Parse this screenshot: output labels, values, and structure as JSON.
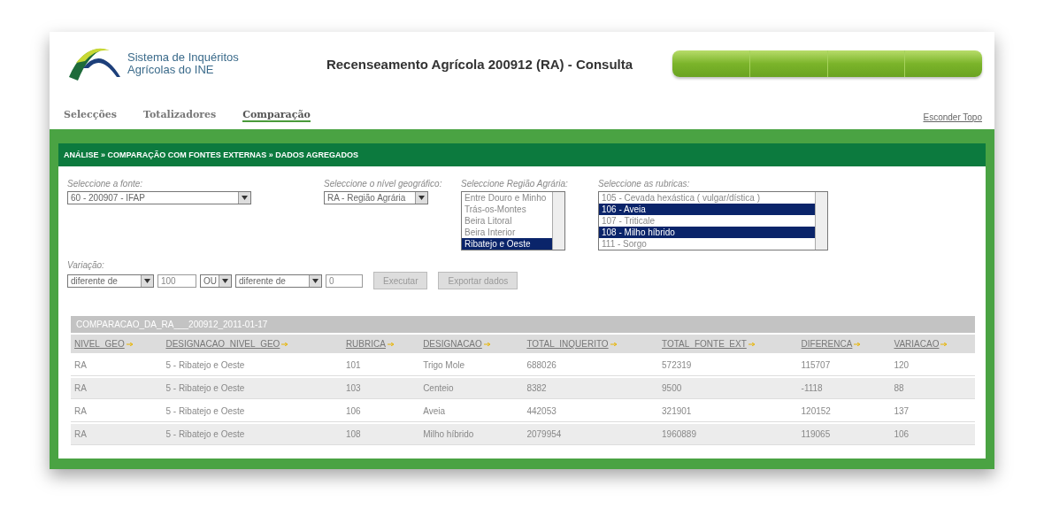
{
  "header": {
    "logo_lines": [
      "Sistema de Inquéritos",
      "Agrícolas do INE"
    ],
    "title": "Recenseamento Agrícola 200912 (RA) - Consulta"
  },
  "nav": {
    "tabs": [
      {
        "label": "Selecções",
        "selected": false
      },
      {
        "label": "Totalizadores",
        "selected": false
      },
      {
        "label": "Comparação",
        "selected": true
      }
    ],
    "hide_link": "Esconder Topo"
  },
  "breadcrumb": "ANÁLISE » COMPARAÇÃO COM FONTES EXTERNAS » DADOS AGREGADOS",
  "filters": {
    "source": {
      "label": "Seleccione a fonte:",
      "value": "60 - 200907 - IFAP"
    },
    "level": {
      "label": "Seleccione o nível geográfico:",
      "value": "RA - Região Agrária"
    },
    "region": {
      "label": "Seleccione Região Agrária:",
      "options": [
        {
          "label": "Entre Douro e Minho",
          "selected": false
        },
        {
          "label": "Trás-os-Montes",
          "selected": false
        },
        {
          "label": "Beira Litoral",
          "selected": false
        },
        {
          "label": "Beira Interior",
          "selected": false
        },
        {
          "label": "Ribatejo e Oeste",
          "selected": true
        }
      ]
    },
    "rubrics": {
      "label": "Seleccione as rubricas:",
      "options": [
        {
          "label": "105 - Cevada hexástica ( vulgar/dística )",
          "selected": false
        },
        {
          "label": "106 - Aveia",
          "selected": true
        },
        {
          "label": "107 - Triticale",
          "selected": false
        },
        {
          "label": "108 - Milho híbrido",
          "selected": true
        },
        {
          "label": "111 - Sorgo",
          "selected": false
        }
      ]
    }
  },
  "variation": {
    "label": "Variação:",
    "controls": [
      {
        "kind": "select",
        "value": "diferente de"
      },
      {
        "kind": "input",
        "value": "100"
      },
      {
        "kind": "select",
        "value": "OU"
      },
      {
        "kind": "select",
        "value": "diferente de"
      },
      {
        "kind": "input",
        "value": "0"
      },
      {
        "kind": "button",
        "value": "Executar"
      },
      {
        "kind": "button",
        "value": "Exportar dados"
      }
    ]
  },
  "table": {
    "caption": "COMPARACAO_DA_RA___200912_2011-01-17",
    "columns": [
      "NIVEL_GEO",
      "DESIGNACAO_NIVEL_GEO",
      "RUBRICA",
      "DESIGNACAO",
      "TOTAL_INQUERITO",
      "TOTAL_FONTE_EXT",
      "DIFERENCA",
      "VARIACAO"
    ],
    "rows": [
      [
        "RA",
        "5 - Ribatejo e Oeste",
        "101",
        "Trigo Mole",
        "688026",
        "572319",
        "115707",
        "120"
      ],
      [
        "RA",
        "5 - Ribatejo e Oeste",
        "103",
        "Centeio",
        "8382",
        "9500",
        "-1118",
        "88"
      ],
      [
        "RA",
        "5 - Ribatejo e Oeste",
        "106",
        "Aveia",
        "442053",
        "321901",
        "120152",
        "137"
      ],
      [
        "RA",
        "5 - Ribatejo e Oeste",
        "108",
        "Milho híbrido",
        "2079954",
        "1960889",
        "119065",
        "106"
      ]
    ]
  }
}
